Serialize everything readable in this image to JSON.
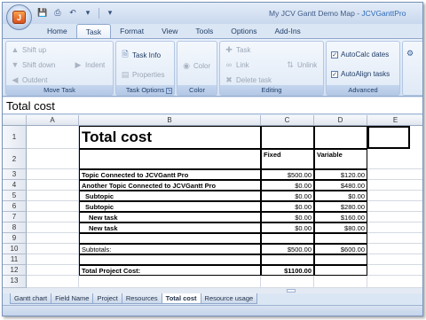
{
  "window": {
    "title_prefix": "My JCV Gantt Demo Map - ",
    "title_app": "JCVGanttPro"
  },
  "qat": {
    "save_icon": "save-icon",
    "undo_icon": "undo-icon",
    "redo_icon": "redo-icon"
  },
  "tabs": [
    "Home",
    "Task",
    "Format",
    "View",
    "Tools",
    "Options",
    "Add-Ins"
  ],
  "active_tab": "Task",
  "ribbon": {
    "move_task": {
      "label": "Move Task",
      "shift_up": "Shift up",
      "shift_down": "Shift down",
      "indent": "Indent",
      "outdent": "Outdent"
    },
    "task_options": {
      "label": "Task Options",
      "task_info": "Task Info",
      "properties": "Properties"
    },
    "color": {
      "label": "Color",
      "color": "Color"
    },
    "editing": {
      "label": "Editing",
      "task": "Task",
      "link": "Link",
      "unlink": "Unlink",
      "delete_task": "Delete task"
    },
    "advanced": {
      "label": "Advanced",
      "autocalc": "AutoCalc dates",
      "autoalign": "AutoAlign tasks"
    }
  },
  "name_box": "Total cost",
  "columns": [
    "A",
    "B",
    "C",
    "D",
    "E"
  ],
  "rows": [
    "1",
    "2",
    "3",
    "4",
    "5",
    "6",
    "7",
    "8",
    "9",
    "10",
    "11",
    "12",
    "13"
  ],
  "sheet": {
    "title": "Total cost",
    "col_fixed": "Fixed",
    "col_variable": "Variable",
    "lines": [
      {
        "label": "Topic Connected to JCVGantt Pro",
        "fixed": "$500.00",
        "variable": "$120.00"
      },
      {
        "label": "Another Topic Connected to JCVGantt Pro",
        "fixed": "$0.00",
        "variable": "$480.00"
      },
      {
        "label": "Subtopic",
        "fixed": "$0.00",
        "variable": "$0.00"
      },
      {
        "label": "Subtopic",
        "fixed": "$0.00",
        "variable": "$280.00"
      },
      {
        "label": "New task",
        "fixed": "$0.00",
        "variable": "$160.00"
      },
      {
        "label": "New task",
        "fixed": "$0.00",
        "variable": "$80.00"
      }
    ],
    "subtotals_label": "Subtotals:",
    "subtotal_fixed": "$500.00",
    "subtotal_variable": "$600.00",
    "total_label": "Total Project Cost:",
    "total_value": "$1100.00"
  },
  "sheet_tabs": [
    "Gantt chart",
    "Field Name",
    "Project",
    "Resources",
    "Total cost",
    "Resource usage"
  ],
  "active_sheet": "Total cost"
}
